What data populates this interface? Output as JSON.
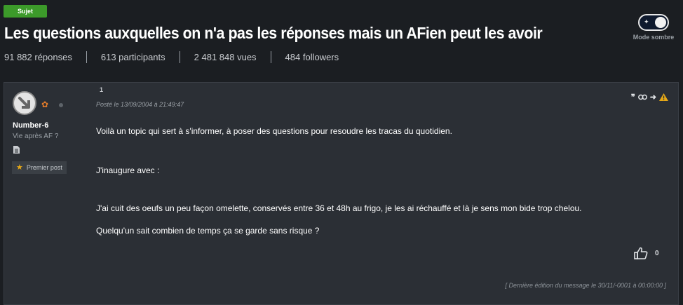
{
  "topic": {
    "badge": "Sujet",
    "title": "Les questions auxquelles on n'a pas les réponses mais un AFien peut les avoir"
  },
  "theme_toggle": {
    "label": "Mode sombre",
    "state": "dark"
  },
  "stats": [
    {
      "label": "91 882 réponses"
    },
    {
      "label": "613 participants"
    },
    {
      "label": "2 481 848 vues"
    },
    {
      "label": "484 followers"
    }
  ],
  "post": {
    "number": "1",
    "date": "Posté le 13/09/2004 à 21:49:47",
    "author": {
      "name": "Number-6",
      "title": "Vie après AF ?",
      "badge": "Premier post"
    },
    "paragraphs": [
      "Voilà un topic qui sert à s'informer, à poser des questions pour resoudre les tracas du quotidien.",
      "J'inaugure avec :",
      "J'ai cuit des oeufs un peu façon omelette, conservés entre 36 et 48h au frigo, je les ai réchauffé et là je sens mon bide trop chelou.",
      "Quelqu'un sait combien de temps ça se garde sans risque ?"
    ],
    "likes": "0",
    "edit_note": "[ Dernière édition du message le 30/11/-0001 à 00:00:00 ]"
  },
  "colors": {
    "background": "#1b1e22",
    "post_background": "#2b2f35",
    "badge_green": "#3c9a2a",
    "warning": "#e6a817"
  }
}
